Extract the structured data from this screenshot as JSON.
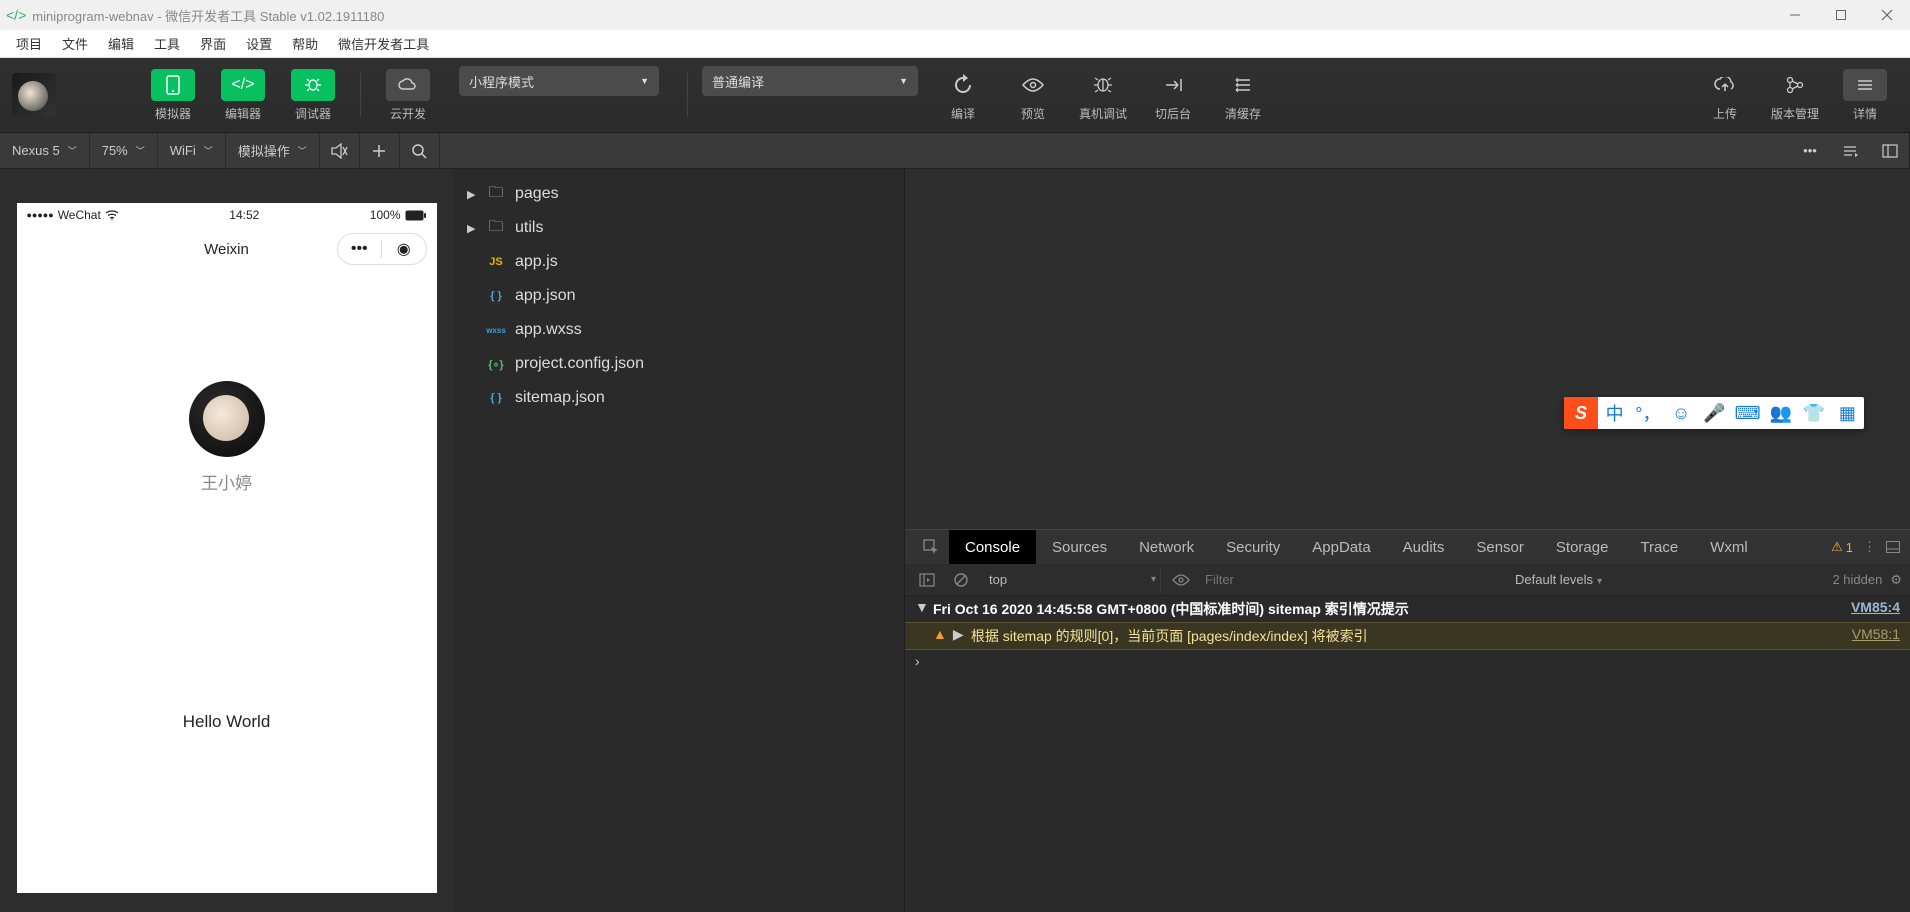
{
  "titlebar": {
    "text": "miniprogram-webnav - 微信开发者工具 Stable v1.02.1911180"
  },
  "menubar": [
    "项目",
    "文件",
    "编辑",
    "工具",
    "界面",
    "设置",
    "帮助",
    "微信开发者工具"
  ],
  "toolbar": {
    "simulator": "模拟器",
    "editor": "编辑器",
    "debugger": "调试器",
    "cloud": "云开发",
    "mode": "小程序模式",
    "compileMode": "普通编译",
    "compile": "编译",
    "preview": "预览",
    "realDebug": "真机调试",
    "background": "切后台",
    "clearCache": "清缓存",
    "upload": "上传",
    "version": "版本管理",
    "details": "详情"
  },
  "simbar": {
    "device": "Nexus 5",
    "zoom": "75%",
    "network": "WiFi",
    "mock": "模拟操作"
  },
  "tree": {
    "folders": [
      "pages",
      "utils"
    ],
    "files": [
      {
        "icon": "js",
        "name": "app.js"
      },
      {
        "icon": "json",
        "name": "app.json"
      },
      {
        "icon": "wxss",
        "name": "app.wxss"
      },
      {
        "icon": "proj",
        "name": "project.config.json"
      },
      {
        "icon": "json",
        "name": "sitemap.json"
      }
    ]
  },
  "phone": {
    "carrier": "WeChat",
    "time": "14:52",
    "battery": "100%",
    "title": "Weixin",
    "username": "王小婷",
    "hello": "Hello World"
  },
  "devtools": {
    "tabs": [
      "Console",
      "Sources",
      "Network",
      "Security",
      "AppData",
      "Audits",
      "Sensor",
      "Storage",
      "Trace",
      "Wxml"
    ],
    "warnCount": "1",
    "context": "top",
    "filterPlaceholder": "Filter",
    "levels": "Default levels",
    "hidden": "2 hidden",
    "groupMsg": "Fri Oct 16 2020 14:45:58 GMT+0800 (中国标准时间) sitemap 索引情况提示",
    "groupSrc": "VM85:4",
    "warnMsg": "根据 sitemap 的规则[0]，当前页面 [pages/index/index] 将被索引",
    "warnSrc": "VM58:1"
  },
  "ime": {
    "s": "S",
    "zh": "中"
  }
}
